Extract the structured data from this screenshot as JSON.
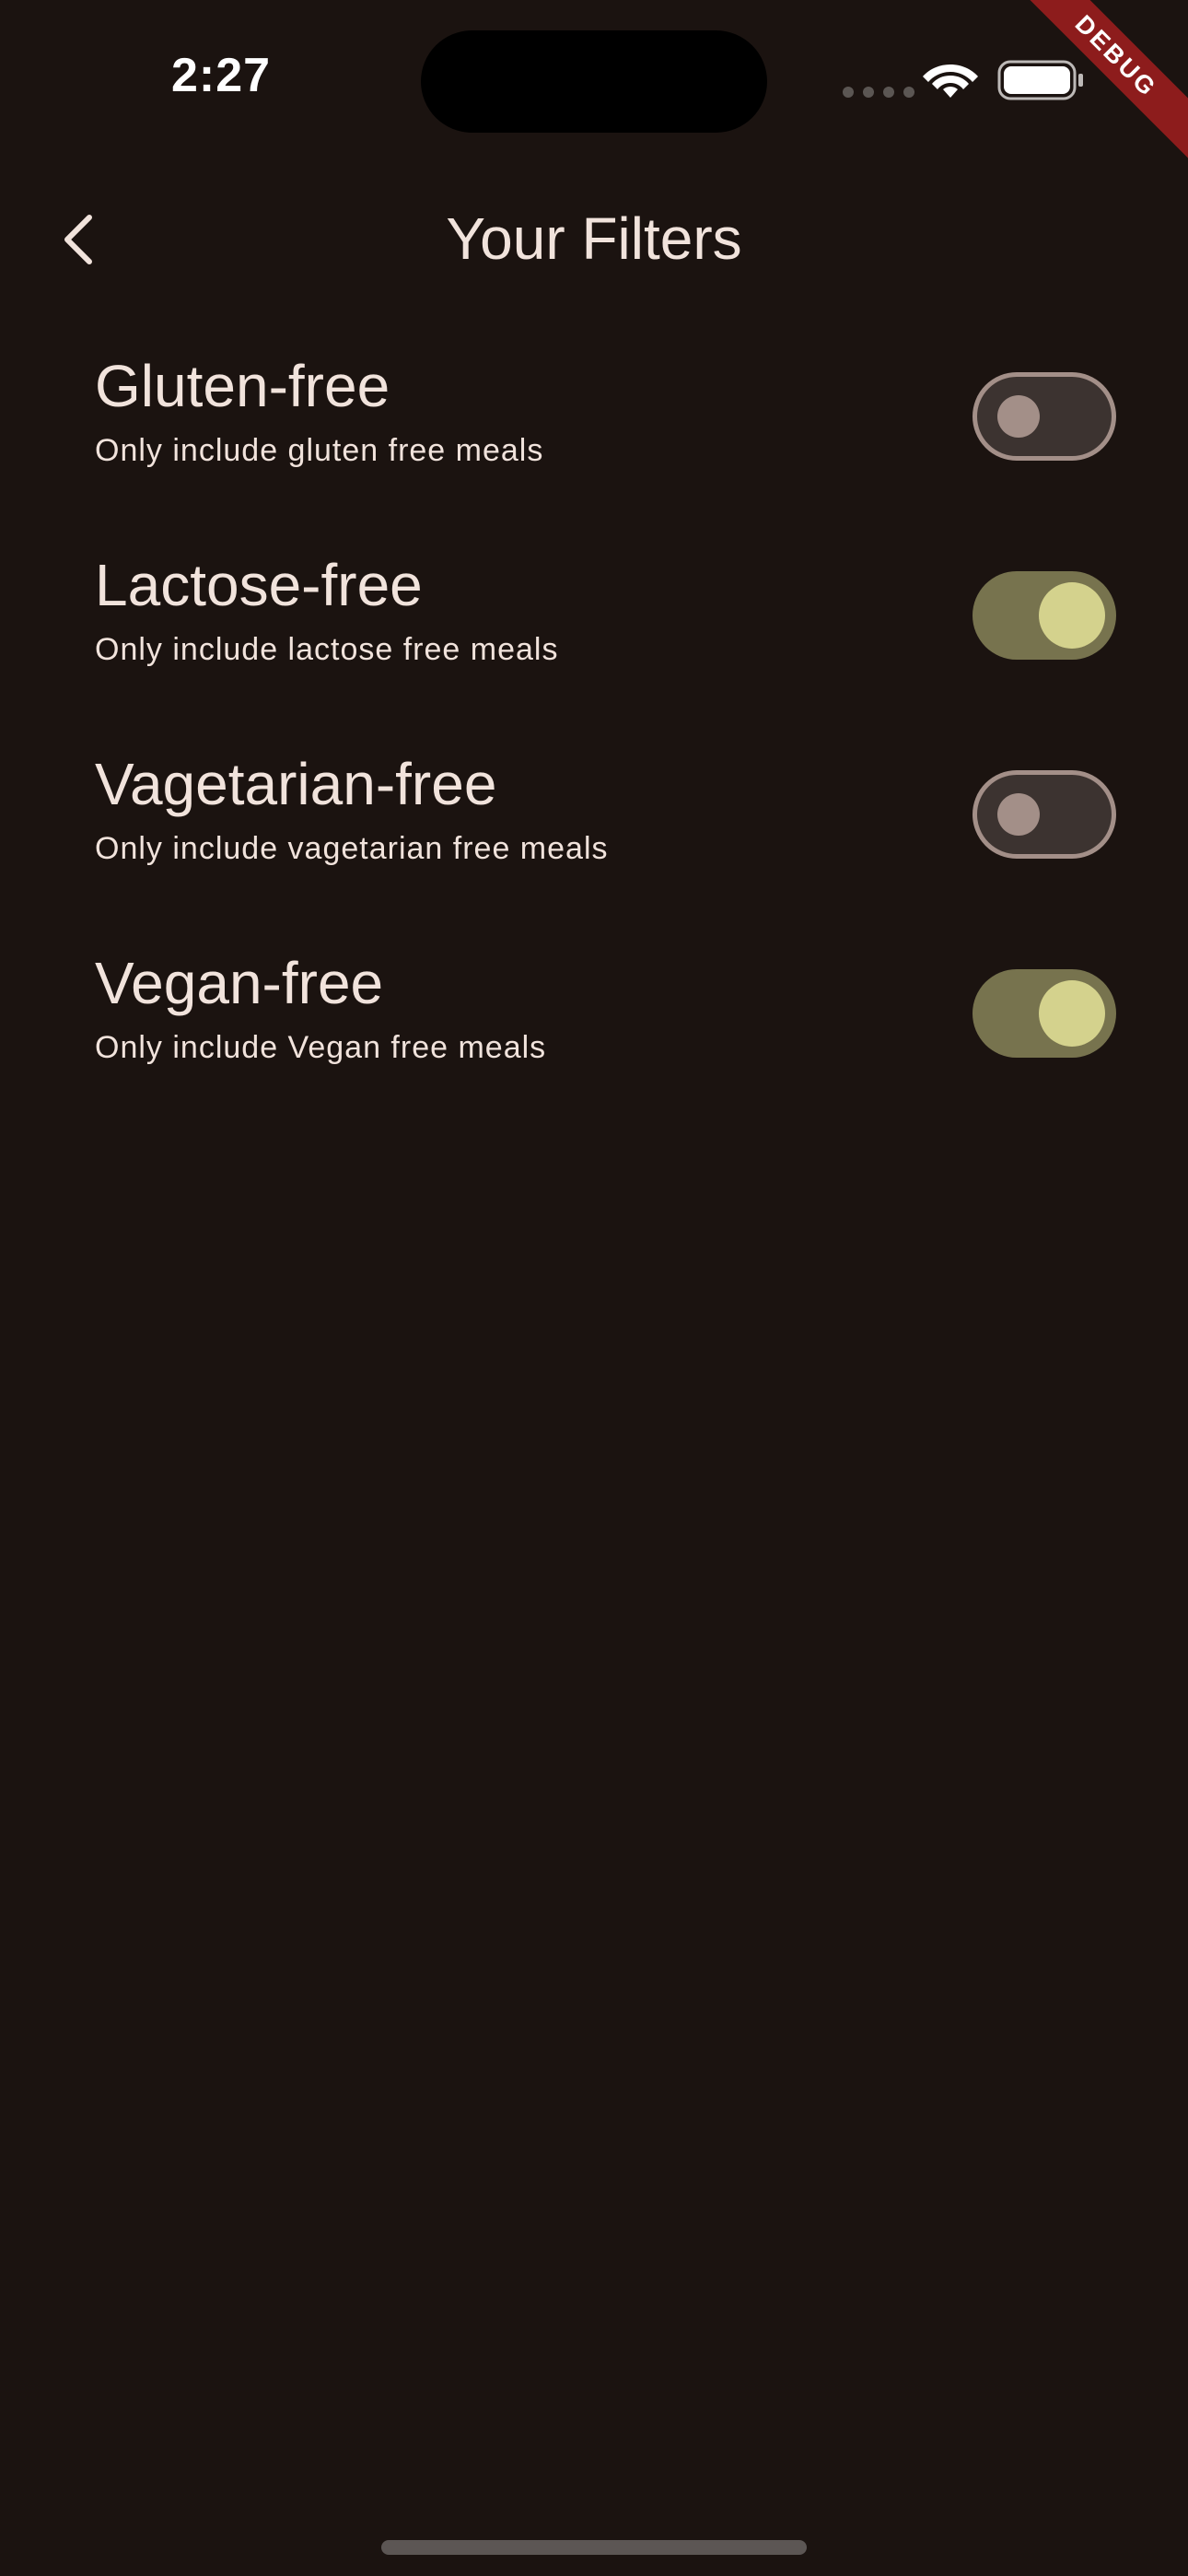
{
  "status_bar": {
    "time": "2:27",
    "signal_icon": "signal-dots-icon",
    "wifi_icon": "wifi-icon",
    "battery_icon": "battery-icon"
  },
  "debug_banner": {
    "label": "DEBUG",
    "color": "#8d1c1c"
  },
  "app_bar": {
    "back_icon": "chevron-left-icon",
    "title": "Your Filters"
  },
  "filters": [
    {
      "title": "Gluten-free",
      "subtitle": "Only include gluten free meals",
      "enabled": false
    },
    {
      "title": "Lactose-free",
      "subtitle": "Only include lactose free meals",
      "enabled": true
    },
    {
      "title": "Vagetarian-free",
      "subtitle": "Only include vagetarian free meals",
      "enabled": false
    },
    {
      "title": "Vegan-free",
      "subtitle": "Only include Vegan free meals",
      "enabled": true
    }
  ],
  "colors": {
    "background": "#1b1310",
    "text": "#f1e3dc",
    "switch_on_track": "#77734e",
    "switch_on_thumb": "#d4d28d",
    "switch_off_track": "#3c3330",
    "switch_off_thumb": "#a38f88"
  }
}
